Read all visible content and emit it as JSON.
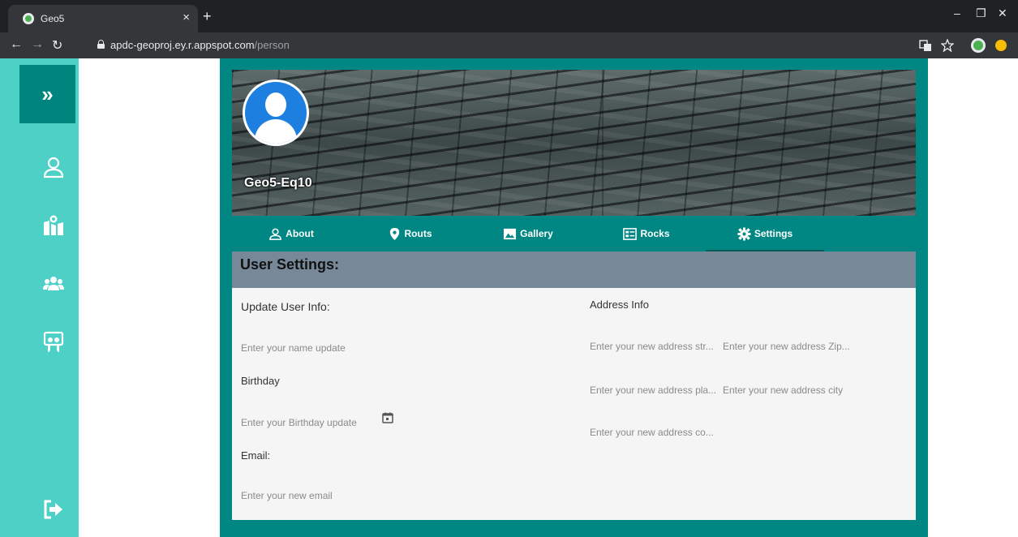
{
  "browser": {
    "tab_title": "Geo5",
    "tab_close": "×",
    "new_tab": "+",
    "url_host": "apdc-geoproj.ey.r.appspot.com",
    "url_path": "/person",
    "minimize": "–",
    "restore": "❐",
    "close": "✕"
  },
  "sidebar": {
    "toggle_glyph": "»",
    "items": [
      {
        "icon": "user-icon"
      },
      {
        "icon": "map-icon"
      },
      {
        "icon": "users-group-icon"
      },
      {
        "icon": "slideshare-icon"
      },
      {
        "icon": "sign-out-icon"
      }
    ],
    "bg_color": "#4dd0c6",
    "active_color": "#00857e"
  },
  "profile": {
    "username": "Geo5-Eq10"
  },
  "tabs": [
    {
      "label": "About",
      "icon": "user-icon"
    },
    {
      "label": "Routs",
      "icon": "map-marker-icon"
    },
    {
      "label": "Gallery",
      "icon": "image-icon"
    },
    {
      "label": "Rocks",
      "icon": "list-card-icon"
    },
    {
      "label": "Settings",
      "icon": "gear-icon",
      "active": true
    }
  ],
  "settings": {
    "header": "User Settings:",
    "update_title": "Update User Info:",
    "name_placeholder": "Enter your name update",
    "birthday_label": "Birthday",
    "birthday_placeholder": "Enter your Birthday update",
    "email_label": "Email:",
    "email_placeholder": "Enter your new email",
    "address_title": "Address Info",
    "street_placeholder": "Enter your new address str...",
    "zip_placeholder": "Enter your new address Zip...",
    "place_placeholder": "Enter your new address pla...",
    "city_placeholder": "Enter your new address city",
    "country_placeholder": "Enter your new address co..."
  },
  "colors": {
    "main_bg": "#008784",
    "panel_header": "#778899",
    "panel_bg": "#f5f5f5"
  }
}
